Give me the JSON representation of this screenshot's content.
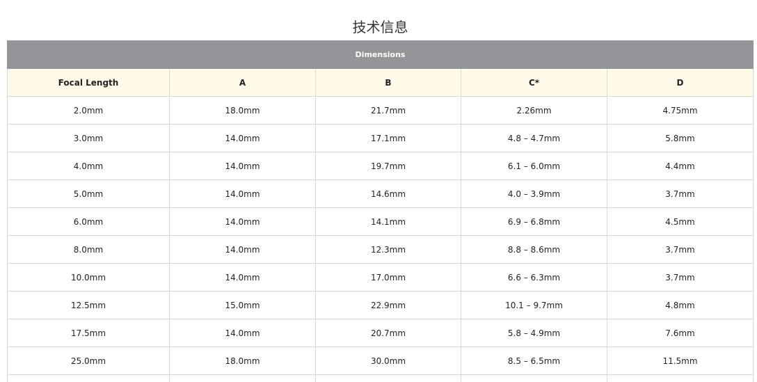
{
  "title": "技术信息",
  "table": {
    "group_header": "Dimensions",
    "columns": [
      "Focal Length",
      "A",
      "B",
      "C*",
      "D"
    ],
    "rows": [
      [
        "2.0mm",
        "18.0mm",
        "21.7mm",
        "2.26mm",
        "4.75mm"
      ],
      [
        "3.0mm",
        "14.0mm",
        "17.1mm",
        "4.8 – 4.7mm",
        "5.8mm"
      ],
      [
        "4.0mm",
        "14.0mm",
        "19.7mm",
        "6.1 – 6.0mm",
        "4.4mm"
      ],
      [
        "5.0mm",
        "14.0mm",
        "14.6mm",
        "4.0 – 3.9mm",
        "3.7mm"
      ],
      [
        "6.0mm",
        "14.0mm",
        "14.1mm",
        "6.9 – 6.8mm",
        "4.5mm"
      ],
      [
        "8.0mm",
        "14.0mm",
        "12.3mm",
        "8.8 – 8.6mm",
        "3.7mm"
      ],
      [
        "10.0mm",
        "14.0mm",
        "17.0mm",
        "6.6 – 6.3mm",
        "3.7mm"
      ],
      [
        "12.5mm",
        "15.0mm",
        "22.9mm",
        "10.1 – 9.7mm",
        "4.8mm"
      ],
      [
        "17.5mm",
        "14.0mm",
        "20.7mm",
        "5.8 – 4.9mm",
        "7.6mm"
      ],
      [
        "25.0mm",
        "18.0mm",
        "30.0mm",
        "8.5 – 6.5mm",
        "11.5mm"
      ]
    ]
  }
}
